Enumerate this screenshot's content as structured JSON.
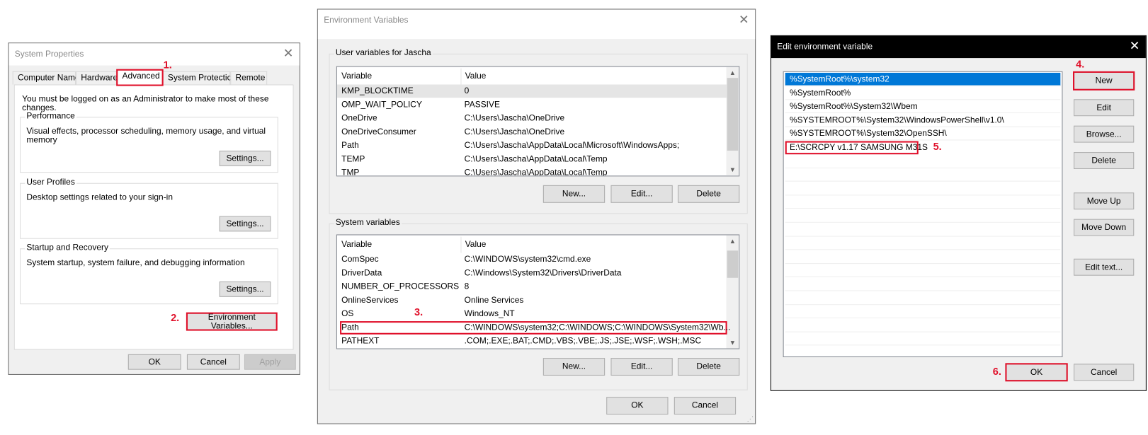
{
  "steps": [
    "1.",
    "2.",
    "3.",
    "4.",
    "5.",
    "6."
  ],
  "accent": "#e0102a",
  "selection_color": "#0078d7",
  "system_properties": {
    "title": "System Properties",
    "tabs": [
      "Computer Name",
      "Hardware",
      "Advanced",
      "System Protection",
      "Remote"
    ],
    "selected_tab": "Advanced",
    "admin_note": "You must be logged on as an Administrator to make most of these changes.",
    "groups": [
      {
        "label": "Performance",
        "description": "Visual effects, processor scheduling, memory usage, and virtual memory",
        "button": "Settings..."
      },
      {
        "label": "User Profiles",
        "description": "Desktop settings related to your sign-in",
        "button": "Settings..."
      },
      {
        "label": "Startup and Recovery",
        "description": "System startup, system failure, and debugging information",
        "button": "Settings..."
      }
    ],
    "env_button": "Environment Variables...",
    "ok": "OK",
    "cancel": "Cancel",
    "apply": "Apply"
  },
  "environment_variables": {
    "title": "Environment Variables",
    "user_group": "User variables for Jascha",
    "system_group": "System variables",
    "columns": [
      "Variable",
      "Value"
    ],
    "user_rows": [
      [
        "KMP_BLOCKTIME",
        "0"
      ],
      [
        "OMP_WAIT_POLICY",
        "PASSIVE"
      ],
      [
        "OneDrive",
        "C:\\Users\\Jascha\\OneDrive"
      ],
      [
        "OneDriveConsumer",
        "C:\\Users\\Jascha\\OneDrive"
      ],
      [
        "Path",
        "C:\\Users\\Jascha\\AppData\\Local\\Microsoft\\WindowsApps;"
      ],
      [
        "TEMP",
        "C:\\Users\\Jascha\\AppData\\Local\\Temp"
      ],
      [
        "TMP",
        "C:\\Users\\Jascha\\AppData\\Local\\Temp"
      ]
    ],
    "system_rows": [
      [
        "ComSpec",
        "C:\\WINDOWS\\system32\\cmd.exe"
      ],
      [
        "DriverData",
        "C:\\Windows\\System32\\Drivers\\DriverData"
      ],
      [
        "NUMBER_OF_PROCESSORS",
        "8"
      ],
      [
        "OnlineServices",
        "Online Services"
      ],
      [
        "OS",
        "Windows_NT"
      ],
      [
        "Path",
        "C:\\WINDOWS\\system32;C:\\WINDOWS;C:\\WINDOWS\\System32\\Wb..."
      ],
      [
        "PATHEXT",
        ".COM;.EXE;.BAT;.CMD;.VBS;.VBE;.JS;.JSE;.WSF;.WSH;.MSC"
      ]
    ],
    "new": "New...",
    "edit": "Edit...",
    "delete": "Delete",
    "ok": "OK",
    "cancel": "Cancel"
  },
  "edit_variable": {
    "title": "Edit environment variable",
    "entries": [
      "%SystemRoot%\\system32",
      "%SystemRoot%",
      "%SystemRoot%\\System32\\Wbem",
      "%SYSTEMROOT%\\System32\\WindowsPowerShell\\v1.0\\",
      "%SYSTEMROOT%\\System32\\OpenSSH\\",
      "E:\\SCRCPY v1.17 SAMSUNG M31S"
    ],
    "buttons": [
      "New",
      "Edit",
      "Browse...",
      "Delete",
      "Move Up",
      "Move Down",
      "Edit text..."
    ],
    "ok": "OK",
    "cancel": "Cancel"
  }
}
